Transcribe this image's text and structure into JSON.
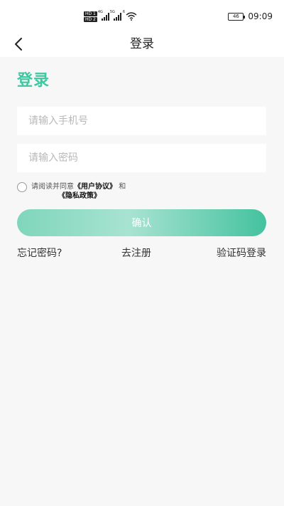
{
  "status_bar": {
    "hd1": "HD 1",
    "hd2": "HD 2",
    "sig1_label": "4G",
    "sig2_label": "5G",
    "wifi_label": "6",
    "battery": "46",
    "time": "09:09"
  },
  "nav": {
    "title": "登录"
  },
  "login": {
    "heading": "登录",
    "phone_placeholder": "请输入手机号",
    "password_placeholder": "请输入密码",
    "agree_prefix": "请阅读并同意",
    "user_agreement": "《用户协议》",
    "and": "和",
    "privacy_policy": "《隐私政策》",
    "confirm_label": "确认",
    "forgot_password": "忘记密码?",
    "register": "去注册",
    "code_login": "验证码登录"
  },
  "colors": {
    "accent": "#3ec7a0",
    "background": "#f7f7f7"
  }
}
